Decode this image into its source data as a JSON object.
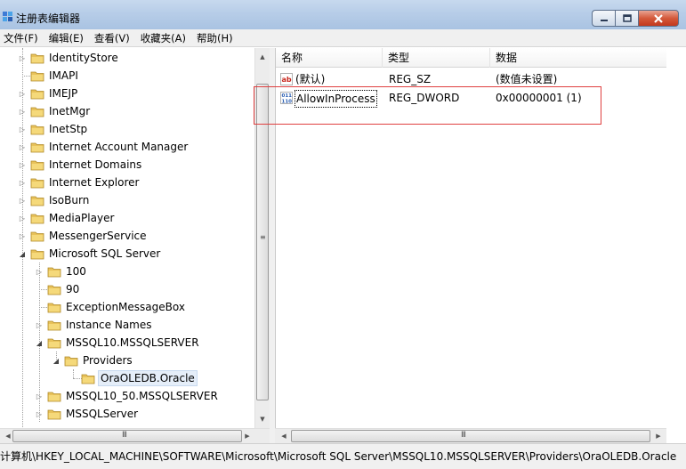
{
  "window": {
    "title": "注册表编辑器"
  },
  "menu": [
    {
      "label": "文件(F)"
    },
    {
      "label": "编辑(E)"
    },
    {
      "label": "查看(V)"
    },
    {
      "label": "收藏夹(A)"
    },
    {
      "label": "帮助(H)"
    }
  ],
  "tree": {
    "items": [
      {
        "label": "IdentityStore",
        "level": 1,
        "expander": "collapsed"
      },
      {
        "label": "IMAPI",
        "level": 1,
        "expander": "none"
      },
      {
        "label": "IMEJP",
        "level": 1,
        "expander": "collapsed"
      },
      {
        "label": "InetMgr",
        "level": 1,
        "expander": "collapsed"
      },
      {
        "label": "InetStp",
        "level": 1,
        "expander": "collapsed"
      },
      {
        "label": "Internet Account Manager",
        "level": 1,
        "expander": "collapsed"
      },
      {
        "label": "Internet Domains",
        "level": 1,
        "expander": "collapsed"
      },
      {
        "label": "Internet Explorer",
        "level": 1,
        "expander": "collapsed"
      },
      {
        "label": "IsoBurn",
        "level": 1,
        "expander": "collapsed"
      },
      {
        "label": "MediaPlayer",
        "level": 1,
        "expander": "collapsed"
      },
      {
        "label": "MessengerService",
        "level": 1,
        "expander": "collapsed"
      },
      {
        "label": "Microsoft SQL Server",
        "level": 1,
        "expander": "expanded"
      },
      {
        "label": "100",
        "level": 2,
        "expander": "collapsed"
      },
      {
        "label": "90",
        "level": 2,
        "expander": "none"
      },
      {
        "label": "ExceptionMessageBox",
        "level": 2,
        "expander": "none"
      },
      {
        "label": "Instance Names",
        "level": 2,
        "expander": "collapsed"
      },
      {
        "label": "MSSQL10.MSSQLSERVER",
        "level": 2,
        "expander": "expanded"
      },
      {
        "label": "Providers",
        "level": 3,
        "expander": "expanded"
      },
      {
        "label": "OraOLEDB.Oracle",
        "level": 4,
        "expander": "none",
        "selected": true
      },
      {
        "label": "MSSQL10_50.MSSQLSERVER",
        "level": 2,
        "expander": "collapsed"
      },
      {
        "label": "MSSQLServer",
        "level": 2,
        "expander": "collapsed"
      }
    ]
  },
  "values": {
    "columns": [
      {
        "label": "名称"
      },
      {
        "label": "类型"
      },
      {
        "label": "数据"
      }
    ],
    "rows": [
      {
        "name": "(默认)",
        "type": "REG_SZ",
        "data": "(数值未设置)",
        "icon": "string-value-icon"
      },
      {
        "name": "AllowInProcess",
        "type": "REG_DWORD",
        "data": "0x00000001 (1)",
        "icon": "binary-value-icon"
      }
    ]
  },
  "statusbar": {
    "path": "计算机\\HKEY_LOCAL_MACHINE\\SOFTWARE\\Microsoft\\Microsoft SQL Server\\MSSQL10.MSSQLSERVER\\Providers\\OraOLEDB.Oracle"
  },
  "colors": {
    "highlight_box": "#e04040",
    "selection": "#e5eef9",
    "folder": "#e8c25a"
  }
}
